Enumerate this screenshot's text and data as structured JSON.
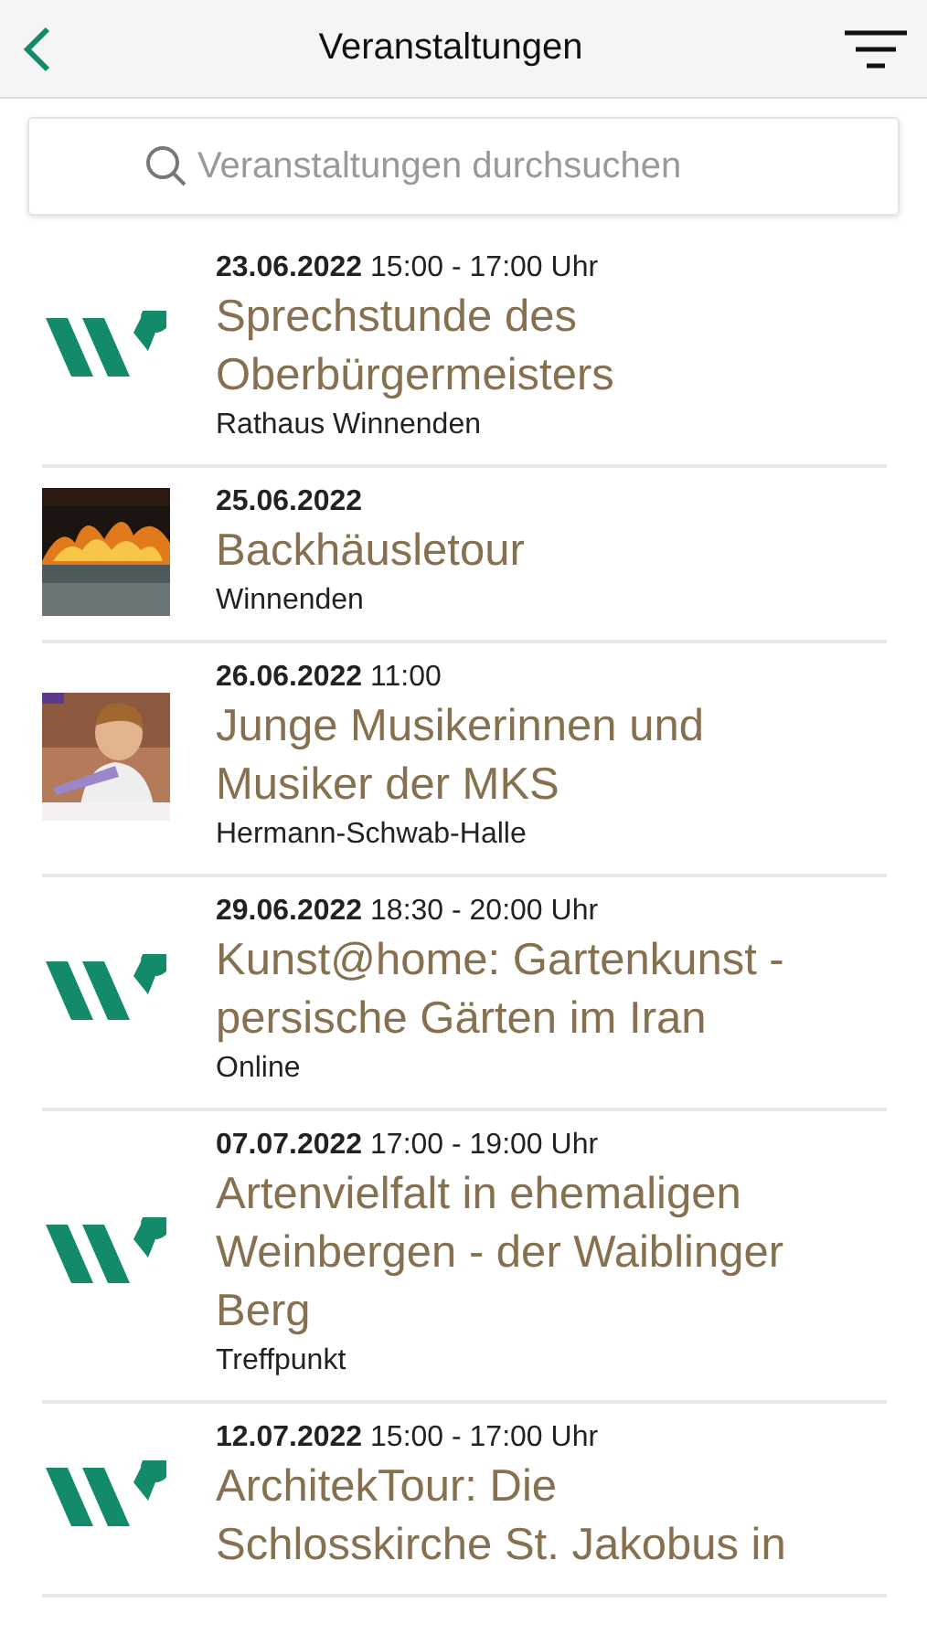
{
  "header": {
    "title": "Veranstaltungen"
  },
  "search": {
    "placeholder": "Veranstaltungen durchsuchen"
  },
  "events": [
    {
      "kind": "logo",
      "date": "23.06.2022",
      "time": "15:00 - 17:00 Uhr",
      "title": "Sprechstunde des Oberbürgermeisters",
      "location": "Rathaus Winnenden"
    },
    {
      "kind": "fire",
      "date": "25.06.2022",
      "title": "Backhäusletour",
      "location": "Winnenden"
    },
    {
      "kind": "musician",
      "date": "26.06.2022",
      "time": "11:00",
      "title": "Junge Musikerinnen und Musiker der MKS",
      "location": "Hermann-Schwab-Halle"
    },
    {
      "kind": "logo",
      "date": "29.06.2022",
      "time": "18:30 - 20:00 Uhr",
      "title": "Kunst@home: Gartenkunst - persische Gärten im Iran",
      "location": "Online"
    },
    {
      "kind": "logo",
      "date": "07.07.2022",
      "time": "17:00 - 19:00 Uhr",
      "title": "Artenvielfalt in ehemaligen Weinbergen - der Waiblinger Berg",
      "location": "Treffpunkt"
    },
    {
      "kind": "logo",
      "date": "12.07.2022",
      "time": "15:00 - 17:00 Uhr",
      "title": "ArchitekTour: Die Schlosskirche St. Jakobus in"
    }
  ]
}
